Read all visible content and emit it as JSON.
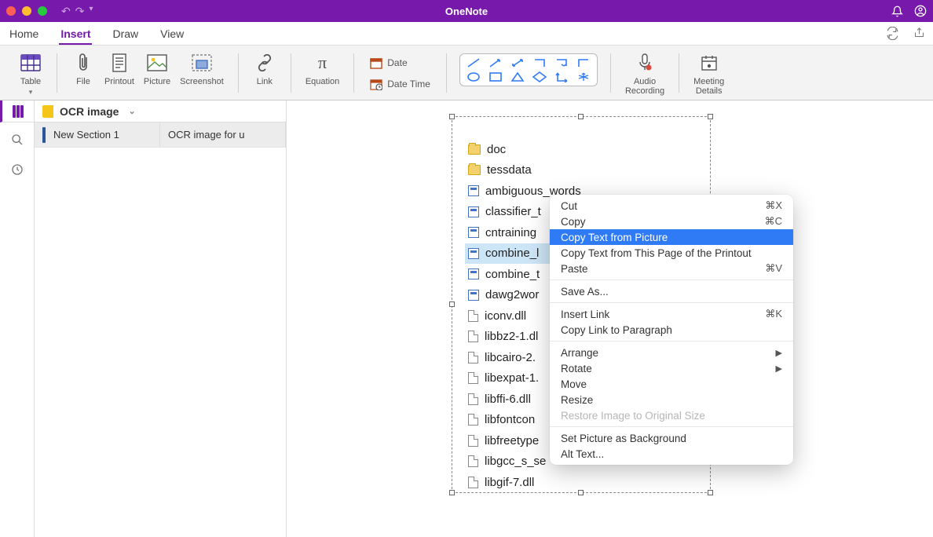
{
  "app": {
    "title": "OneNote"
  },
  "menu": {
    "items": [
      "Home",
      "Insert",
      "Draw",
      "View"
    ],
    "active": "Insert"
  },
  "ribbon": {
    "table": "Table",
    "file": "File",
    "printout": "Printout",
    "picture": "Picture",
    "screenshot": "Screenshot",
    "link": "Link",
    "equation": "Equation",
    "date": "Date",
    "datetime": "Date  Time",
    "audio1": "Audio",
    "audio2": "Recording",
    "meeting1": "Meeting",
    "meeting2": "Details"
  },
  "notebook": {
    "name": "OCR image"
  },
  "section": {
    "name": "New Section 1"
  },
  "page": {
    "name": "OCR image for u"
  },
  "files": [
    {
      "type": "folder",
      "name": "doc"
    },
    {
      "type": "folder",
      "name": "tessdata"
    },
    {
      "type": "exe",
      "name": "ambiguous_words"
    },
    {
      "type": "exe",
      "name": "classifier_t"
    },
    {
      "type": "exe",
      "name": "cntraining"
    },
    {
      "type": "exe",
      "name": "combine_l",
      "selected": true
    },
    {
      "type": "exe",
      "name": "combine_t"
    },
    {
      "type": "exe",
      "name": "dawg2wor"
    },
    {
      "type": "dll",
      "name": "iconv.dll"
    },
    {
      "type": "dll",
      "name": "libbz2-1.dl"
    },
    {
      "type": "dll",
      "name": "libcairo-2."
    },
    {
      "type": "dll",
      "name": "libexpat-1."
    },
    {
      "type": "dll",
      "name": "libffi-6.dll"
    },
    {
      "type": "dll",
      "name": "libfontcon"
    },
    {
      "type": "dll",
      "name": "libfreetype"
    },
    {
      "type": "dll",
      "name": "libgcc_s_se"
    },
    {
      "type": "dll",
      "name": "libgif-7.dll"
    }
  ],
  "context_menu": {
    "groups": [
      [
        {
          "label": "Cut",
          "shortcut": "⌘X"
        },
        {
          "label": "Copy",
          "shortcut": "⌘C"
        },
        {
          "label": "Copy Text from Picture",
          "highlighted": true
        },
        {
          "label": "Copy Text from This Page of the Printout"
        },
        {
          "label": "Paste",
          "shortcut": "⌘V"
        }
      ],
      [
        {
          "label": "Save As..."
        }
      ],
      [
        {
          "label": "Insert Link",
          "shortcut": "⌘K"
        },
        {
          "label": "Copy Link to Paragraph"
        }
      ],
      [
        {
          "label": "Arrange",
          "submenu": true
        },
        {
          "label": "Rotate",
          "submenu": true
        },
        {
          "label": "Move"
        },
        {
          "label": "Resize"
        },
        {
          "label": "Restore Image to Original Size",
          "disabled": true
        }
      ],
      [
        {
          "label": "Set Picture as Background"
        },
        {
          "label": "Alt Text..."
        }
      ]
    ]
  }
}
